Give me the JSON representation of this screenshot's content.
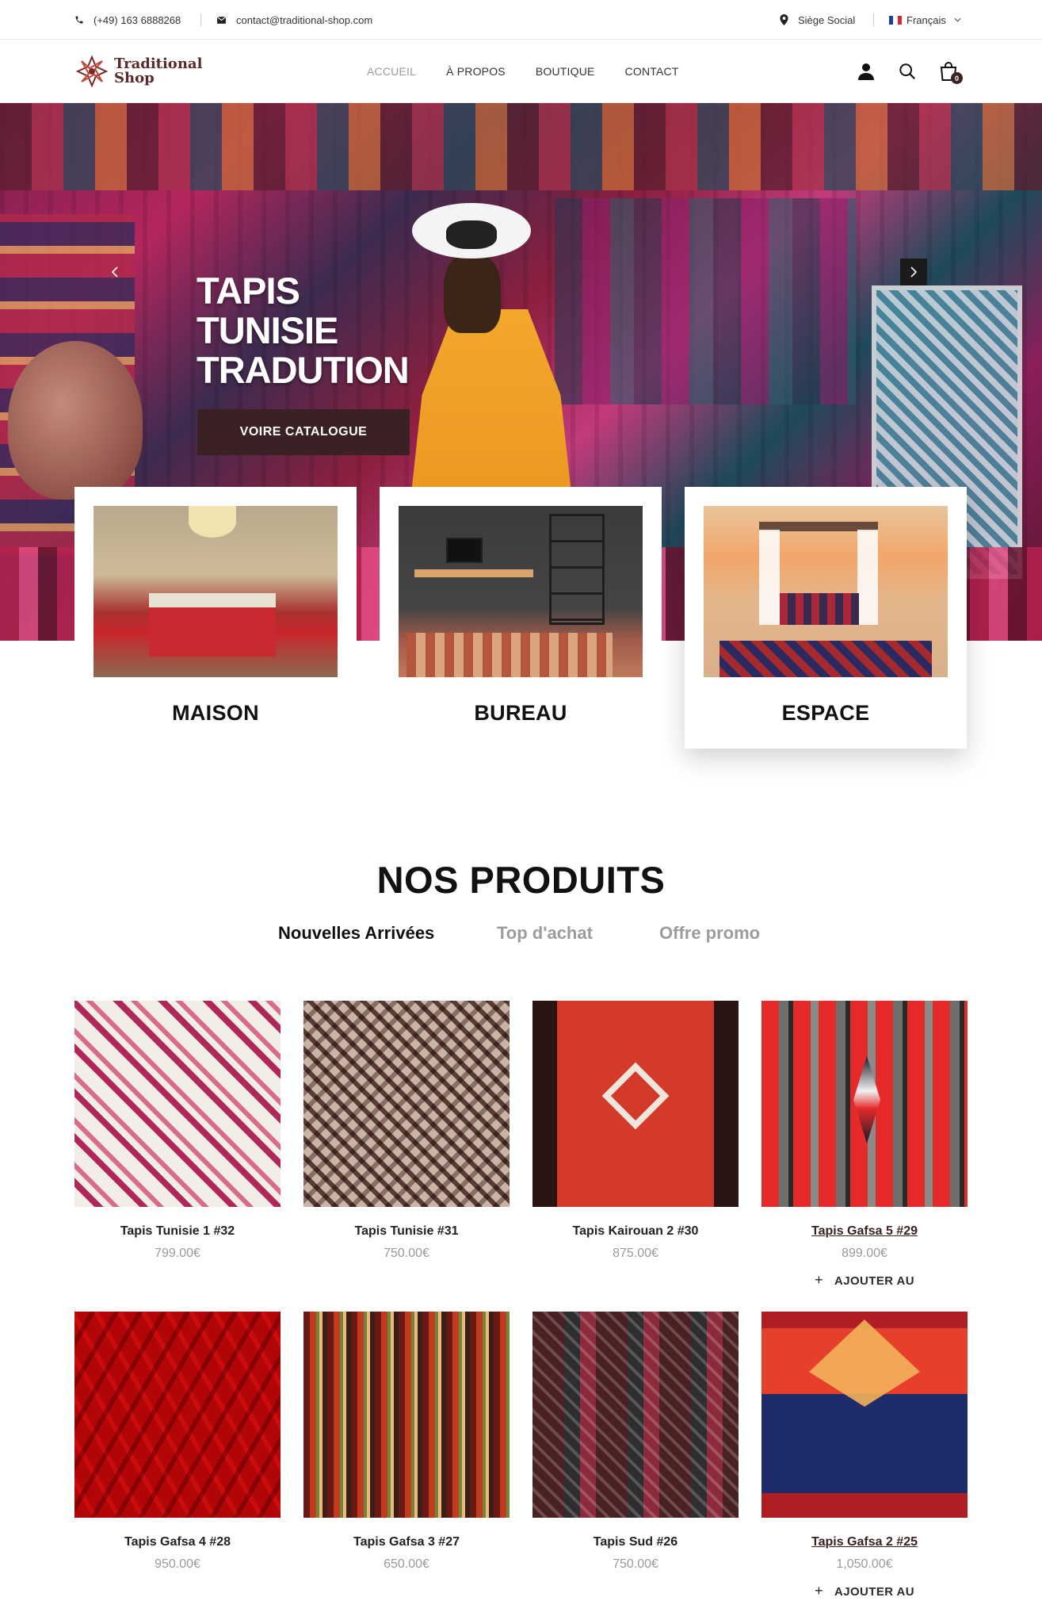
{
  "topbar": {
    "phone": "(+49) 163 6888268",
    "email": "contact@traditional-shop.com",
    "location": "Siège Social",
    "language": "Français"
  },
  "header": {
    "logo_line1": "Traditional",
    "logo_line2": "Shop",
    "nav": [
      "ACCUEIL",
      "À PROPOS",
      "BOUTIQUE",
      "CONTACT"
    ],
    "cart_count": "0"
  },
  "hero": {
    "title": "TAPIS TUNISIE TRADUTION",
    "cta": "VOIRE CATALOGUE"
  },
  "categories": [
    {
      "label": "MAISON"
    },
    {
      "label": "BUREAU"
    },
    {
      "label": "ESPACE"
    }
  ],
  "products_section": {
    "title": "NOS PRODUITS",
    "tabs": [
      "Nouvelles Arrivées",
      "Top d'achat",
      "Offre promo"
    ]
  },
  "products": [
    {
      "name": "Tapis Tunisie 1 #32",
      "price": "799.00€"
    },
    {
      "name": "Tapis Tunisie #31",
      "price": "750.00€"
    },
    {
      "name": "Tapis Kairouan 2 #30",
      "price": "875.00€"
    },
    {
      "name": "Tapis Gafsa 5 #29",
      "price": "899.00€",
      "action": "AJOUTER AU"
    },
    {
      "name": "Tapis Gafsa 4 #28",
      "price": "950.00€"
    },
    {
      "name": "Tapis Gafsa 3 #27",
      "price": "650.00€"
    },
    {
      "name": "Tapis Sud #26",
      "price": "750.00€"
    },
    {
      "name": "Tapis Gafsa 2 #25",
      "price": "1,050.00€",
      "action": "AJOUTER AU"
    }
  ],
  "colors": {
    "brand_dark": "#3a2123",
    "nav_active": "#9a9a9a",
    "price": "#9a9a9a"
  }
}
